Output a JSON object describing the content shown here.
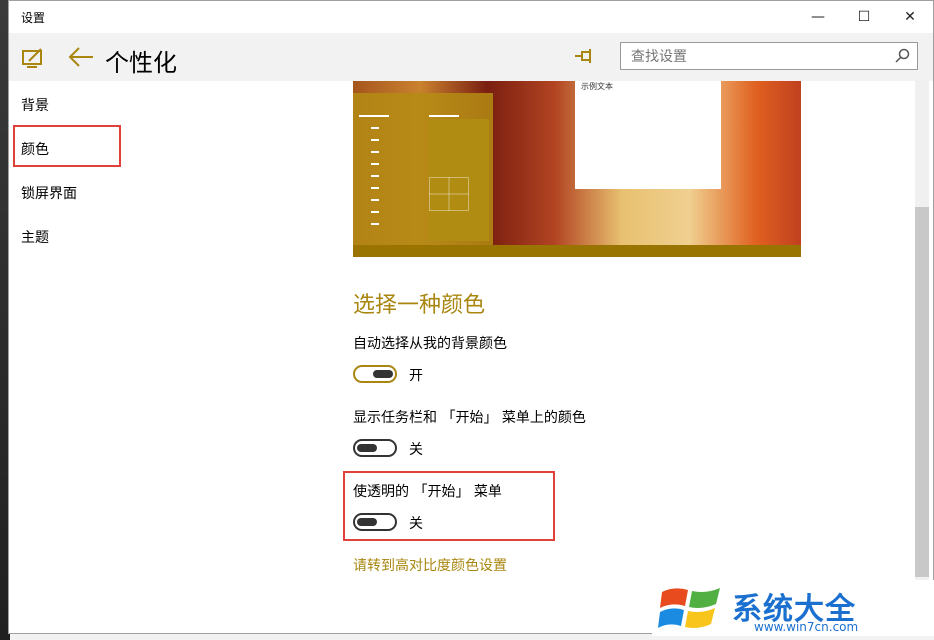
{
  "window": {
    "title": "设置",
    "controls": {
      "minimize": "—",
      "maximize": "☐",
      "close": "✕"
    }
  },
  "header": {
    "page_title": "个性化",
    "search_placeholder": "查找设置"
  },
  "sidebar": {
    "items": [
      {
        "label": "背景"
      },
      {
        "label": "颜色"
      },
      {
        "label": "锁屏界面"
      },
      {
        "label": "主题"
      }
    ],
    "selected": "颜色"
  },
  "preview": {
    "sample_text": "示例文本"
  },
  "colors_section": {
    "title": "选择一种颜色",
    "settings": [
      {
        "label": "自动选择从我的背景颜色",
        "state": "开",
        "on": true
      },
      {
        "label": "显示任务栏和 「开始」 菜单上的颜色",
        "state": "关",
        "on": false
      },
      {
        "label": "使透明的 「开始」 菜单",
        "state": "关",
        "on": false
      }
    ],
    "high_contrast_link": "请转到高对比度颜色设置"
  },
  "watermark": {
    "name": "系统大全",
    "url": "www.win7cn.com"
  },
  "colors": {
    "accent": "#a8860f",
    "highlight_border": "#e0423b",
    "watermark_blue": "#1a6fcf"
  },
  "icons": [
    "personalize-icon",
    "back-arrow-icon",
    "pin-icon",
    "search-icon",
    "windows-logo-icon"
  ]
}
